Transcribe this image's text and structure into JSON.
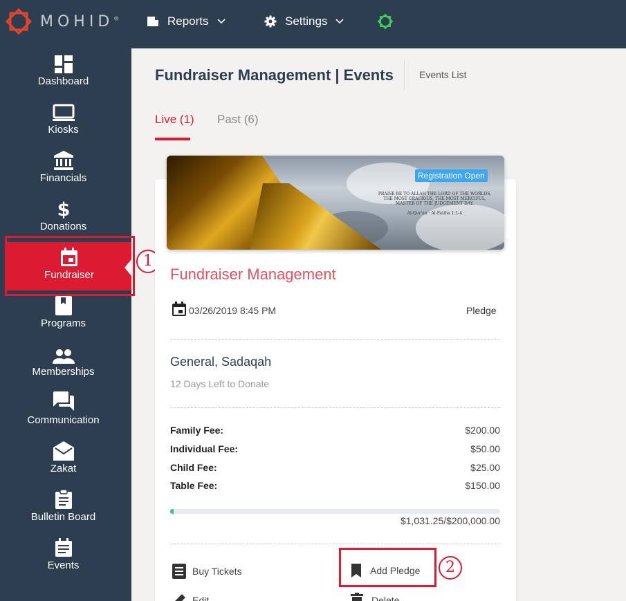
{
  "app": {
    "logo_text": "MOHID",
    "trademark": "®"
  },
  "topnav": {
    "reports_label": "Reports",
    "settings_label": "Settings"
  },
  "sidebar": {
    "items": [
      {
        "label": "Dashboard",
        "icon": "dashboard-icon"
      },
      {
        "label": "Kiosks",
        "icon": "monitor-icon"
      },
      {
        "label": "Financials",
        "icon": "bank-icon"
      },
      {
        "label": "Donations",
        "icon": "dollar-icon"
      },
      {
        "label": "Fundraiser",
        "icon": "calendar-icon",
        "active": true
      },
      {
        "label": "Programs",
        "icon": "book-icon"
      },
      {
        "label": "Memberships",
        "icon": "people-icon"
      },
      {
        "label": "Communication",
        "icon": "chat-icon"
      },
      {
        "label": "Zakat",
        "icon": "envelope-icon"
      },
      {
        "label": "Bulletin Board",
        "icon": "clipboard-icon"
      },
      {
        "label": "Events",
        "icon": "event-icon"
      }
    ]
  },
  "annotations": {
    "step1": "1",
    "step2": "2"
  },
  "header": {
    "title": "Fundraiser Management | Events",
    "breadcrumb": "Events List"
  },
  "tabs": [
    {
      "label": "Live (1)",
      "active": true
    },
    {
      "label": "Past (6)",
      "active": false
    }
  ],
  "event": {
    "badge": "Registration Open",
    "banner_quote": "PRAISE BE TO ALLAH THE LORD OF THE WORLDS, THE MOST GRACIOUS, THE MOST MERCIFUL, MASTER OF THE JUDGEMENT DAY.",
    "banner_source": "Al-Qur'an · Al-Fatiha 1:1-4",
    "title": "Fundraiser Management",
    "date": "03/26/2019 8:45 PM",
    "type": "Pledge",
    "category": "General, Sadaqah",
    "days_left": "12 Days Left to Donate",
    "fees": [
      {
        "label": "Family Fee:",
        "value": "$200.00"
      },
      {
        "label": "Individual Fee:",
        "value": "$50.00"
      },
      {
        "label": "Child Fee:",
        "value": "$25.00"
      },
      {
        "label": "Table Fee:",
        "value": "$150.00"
      }
    ],
    "progress_fraction": 0.0052,
    "progress_text": "$1,031.25/$200,000.00",
    "actions": {
      "buy_tickets": "Buy Tickets",
      "add_pledge": "Add Pledge",
      "edit": "Edit",
      "delete": "Delete"
    }
  },
  "colors": {
    "sidebar_bg": "#2c3e50",
    "accent": "#dc1a31",
    "title_red": "#e6505f",
    "badge_blue": "#3aa7f0",
    "progress_green": "#2ec4a0"
  }
}
